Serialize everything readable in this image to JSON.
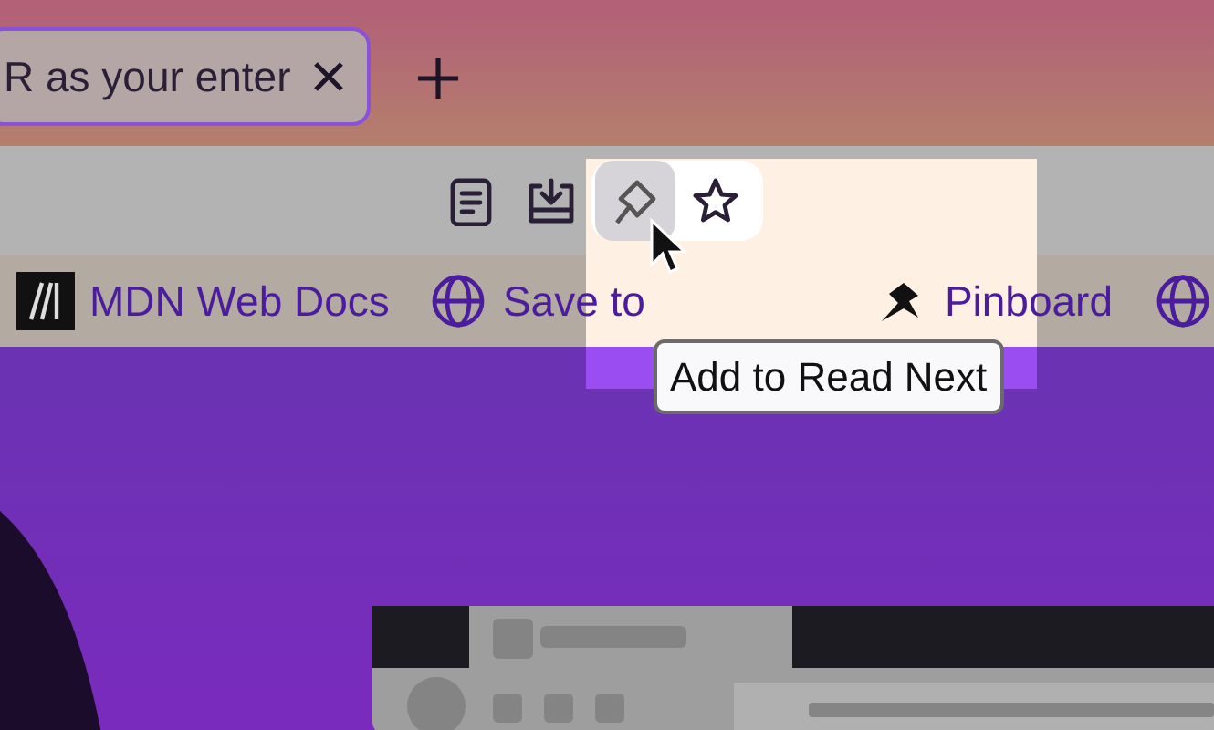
{
  "tab": {
    "title": "R as your enter",
    "selected": true
  },
  "toolbar_buttons": [
    {
      "kind": "reader",
      "highlighted": false
    },
    {
      "kind": "save",
      "highlighted": false
    },
    {
      "kind": "pin",
      "highlighted": true
    },
    {
      "kind": "star",
      "highlighted": false
    }
  ],
  "bookmarks": [
    {
      "kind": "mdn",
      "label": "MDN Web Docs"
    },
    {
      "kind": "globe",
      "label": "Save to"
    },
    {
      "kind": "pin",
      "label": "Pinboard"
    },
    {
      "kind": "globe"
    }
  ],
  "tooltip": {
    "text": "Add to Read Next"
  }
}
